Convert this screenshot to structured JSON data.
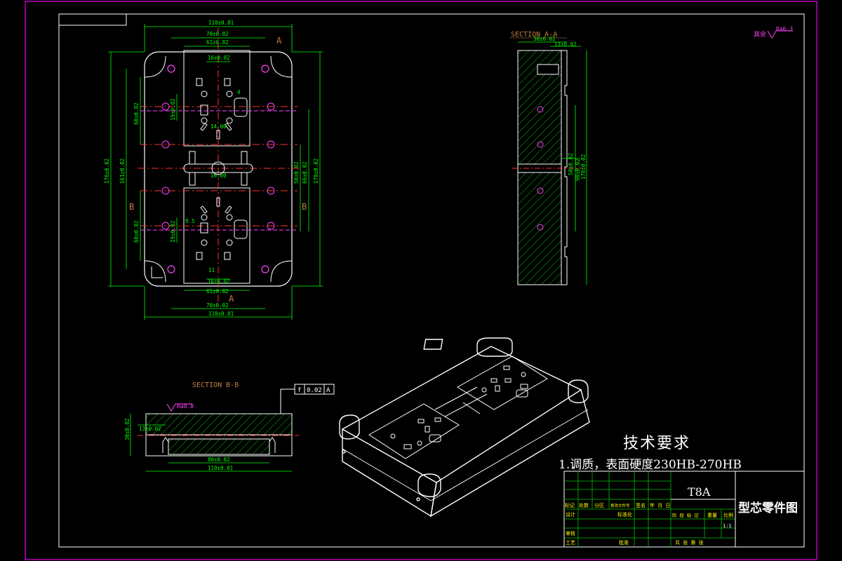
{
  "colors": {
    "background": "#000000",
    "border": "#c000c0",
    "dimension": "#00ff00",
    "outline": "#ffffff",
    "center": "#ff3030",
    "hole": "#ff40ff",
    "hatch": "#00c000",
    "label": "#c08040",
    "cyan": "#00ffff"
  },
  "top_view": {
    "label_a_top": "A",
    "label_a_bottom": "A",
    "label_b_left": "B",
    "label_b_right": "B",
    "dims": {
      "overall_width_top": "110±0.01",
      "w70_top": "70±0.02",
      "w61_top": "61±0.02",
      "w16_top": "16±0.02",
      "w14": "14.00",
      "w16b": "16.00",
      "w16_bottom": "16±0.02",
      "w61_bottom": "61±0.02",
      "w70_bottom": "70±0.02",
      "overall_width_bottom": "110±0.01",
      "h176": "176±0.02",
      "h161": "161±0.02",
      "h60_top": "60±0.02",
      "h60_bottom": "60±0.02",
      "h19_top": "19±0.02",
      "h19_bottom": "19±0.02",
      "h50": "50±0.02",
      "h66": "66±0.02",
      "h178": "178±0.02",
      "small_4": "4",
      "small_9": "9.5",
      "small_11": "11"
    }
  },
  "section_a": {
    "title": "SECTION A-A",
    "dim_13": "13±0.02",
    "dim_30": "30±0.02",
    "dim_50": "50±0.02",
    "dim_90": "90±0.02",
    "dim_178": "178±0.02"
  },
  "section_b": {
    "title": "SECTION B-B",
    "tolerance_symbol": "f",
    "tolerance_value": "0.02",
    "tolerance_datum": "A",
    "roughness": "Ra0.8",
    "dim_13": "13±0.02",
    "dim_30": "30±0.02",
    "dim_80": "80±0.02",
    "dim_110": "110±0.01"
  },
  "roughness_corner": {
    "prefix": "其余",
    "value": "Ra6.3"
  },
  "tech_requirements": {
    "title": "技术要求",
    "item1": "1.调质，表面硬度230HB-270HB"
  },
  "title_block": {
    "material": "T8A",
    "drawing_name": "型芯零件图",
    "scale": "1:1",
    "header_labels": [
      "标记",
      "处数",
      "分区",
      "更改文件号",
      "签名",
      "年 月 日"
    ],
    "row_labels": [
      "设计",
      "标准化",
      "审核",
      "工艺",
      "批准"
    ],
    "col_labels": [
      "阶 段 标 记",
      "重量",
      "比例"
    ],
    "sheet_text": "共  张  第  张"
  }
}
